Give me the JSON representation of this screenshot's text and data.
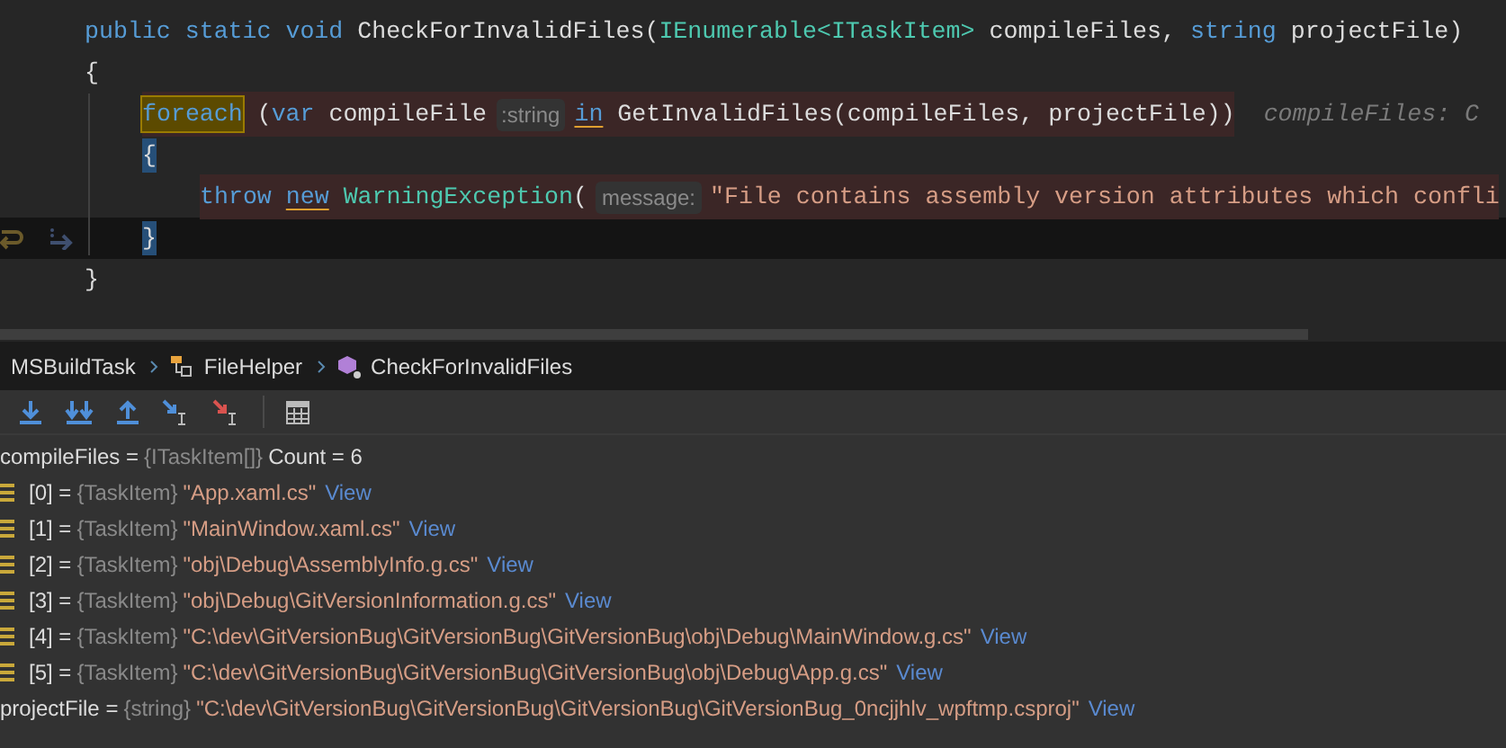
{
  "code": {
    "lines": [
      {
        "highlighted": false,
        "current": false,
        "tokens": [
          {
            "kind": "keyword",
            "text": "public static void"
          },
          {
            "kind": "plain",
            "text": " CheckForInvalidFiles("
          },
          {
            "kind": "type",
            "text": "IEnumerable<ITaskItem>"
          },
          {
            "kind": "plain",
            "text": " compileFiles, "
          },
          {
            "kind": "keyword",
            "text": "string"
          },
          {
            "kind": "plain",
            "text": " projectFile)"
          }
        ]
      },
      {
        "highlighted": false,
        "current": false,
        "tokens": [
          {
            "kind": "plain",
            "text": "{"
          }
        ],
        "children": [
          {
            "highlighted": true,
            "current": false,
            "tokens": [
              {
                "kind": "keyword",
                "text": "foreach",
                "boxed": true
              },
              {
                "kind": "plain",
                "text": " ("
              },
              {
                "kind": "keyword",
                "text": "var"
              },
              {
                "kind": "plain",
                "text": " compileFile"
              },
              {
                "kind": "hint",
                "text": ":string"
              },
              {
                "kind": "keyword",
                "text": "in",
                "underlined": true
              },
              {
                "kind": "plain",
                "text": " GetInvalidFiles(compileFiles, projectFile))"
              }
            ],
            "inline_value": "compileFiles: C"
          },
          {
            "highlighted": false,
            "current": false,
            "tokens": [
              {
                "kind": "plain",
                "text": "{",
                "matched": true
              }
            ],
            "children": [
              {
                "highlighted": true,
                "current": false,
                "tokens": [
                  {
                    "kind": "keyword",
                    "text": "throw "
                  },
                  {
                    "kind": "keyword",
                    "text": "new",
                    "underlined": true
                  },
                  {
                    "kind": "type",
                    "text": " WarningException"
                  },
                  {
                    "kind": "plain",
                    "text": "("
                  },
                  {
                    "kind": "hint",
                    "text": "message:"
                  },
                  {
                    "kind": "string",
                    "text": "\"File contains assembly version attributes which confli"
                  }
                ]
              }
            ]
          },
          {
            "highlighted": false,
            "current": true,
            "tokens": [
              {
                "kind": "plain",
                "text": "}",
                "matched": true
              }
            ]
          }
        ]
      },
      {
        "highlighted": false,
        "current": false,
        "tokens": [
          {
            "kind": "plain",
            "text": "}"
          }
        ]
      }
    ]
  },
  "breadcrumb": [
    {
      "kind": "project",
      "text": "MSBuildTask"
    },
    {
      "kind": "class",
      "text": "FileHelper"
    },
    {
      "kind": "method",
      "text": "CheckForInvalidFiles"
    }
  ],
  "toolbar": [
    {
      "kind": "step-over"
    },
    {
      "kind": "step-into"
    },
    {
      "kind": "step-out"
    },
    {
      "kind": "run-to-cursor"
    },
    {
      "kind": "force-run-to-cursor"
    },
    {
      "kind": "evaluate"
    }
  ],
  "variables": [
    {
      "name": "compileFiles =",
      "type": "{ITaskItem[]}",
      "kind": "collection",
      "value": "Count = 6",
      "children": [
        {
          "name": "[0] =",
          "type": "{TaskItem}",
          "kind": "string",
          "value": "\"App.xaml.cs\"",
          "link": "View"
        },
        {
          "name": "[1] =",
          "type": "{TaskItem}",
          "kind": "string",
          "value": "\"MainWindow.xaml.cs\"",
          "link": "View"
        },
        {
          "name": "[2] =",
          "type": "{TaskItem}",
          "kind": "string",
          "value": "\"obj\\Debug\\AssemblyInfo.g.cs\"",
          "link": "View"
        },
        {
          "name": "[3] =",
          "type": "{TaskItem}",
          "kind": "string",
          "value": "\"obj\\Debug\\GitVersionInformation.g.cs\"",
          "link": "View"
        },
        {
          "name": "[4] =",
          "type": "{TaskItem}",
          "kind": "string",
          "value": "\"C:\\dev\\GitVersionBug\\GitVersionBug\\GitVersionBug\\obj\\Debug\\MainWindow.g.cs\"",
          "link": "View"
        },
        {
          "name": "[5] =",
          "type": "{TaskItem}",
          "kind": "string",
          "value": "\"C:\\dev\\GitVersionBug\\GitVersionBug\\GitVersionBug\\obj\\Debug\\App.g.cs\"",
          "link": "View"
        }
      ]
    },
    {
      "name": "projectFile =",
      "type": "{string}",
      "kind": "string",
      "value": "\"C:\\dev\\GitVersionBug\\GitVersionBug\\GitVersionBug\\GitVersionBug_0ncjjhlv_wpftmp.csproj\"",
      "link": "View"
    }
  ]
}
